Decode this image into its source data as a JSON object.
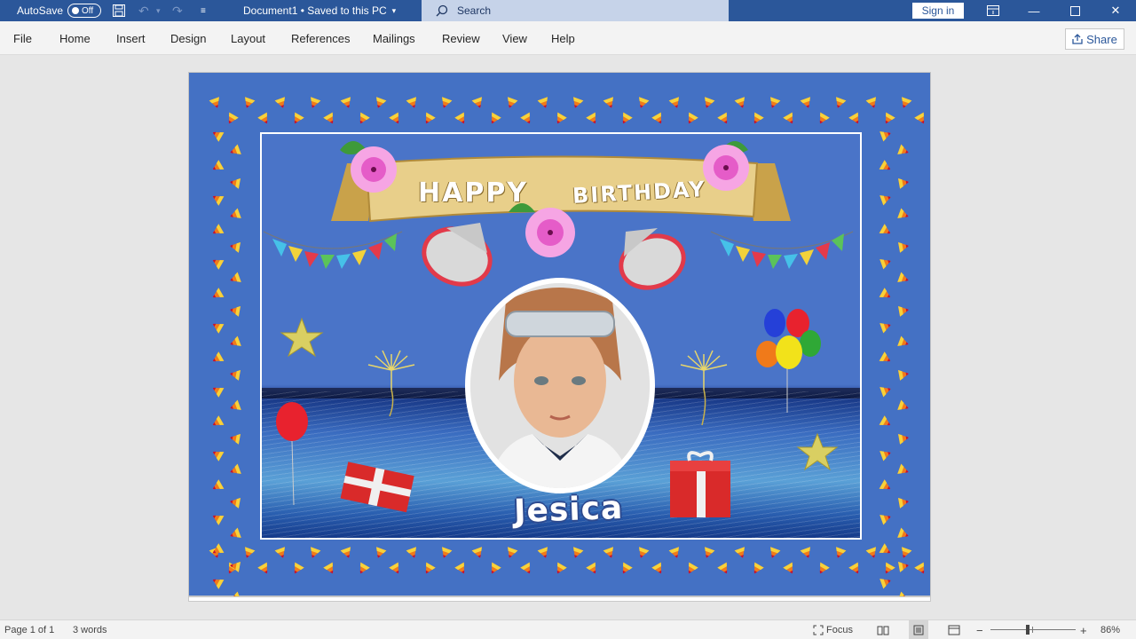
{
  "titlebar": {
    "autosave_label": "AutoSave",
    "autosave_state": "Off",
    "doc_title": "Document1 • Saved to this PC",
    "search_placeholder": "Search",
    "signin_label": "Sign in"
  },
  "ribbon": {
    "tabs": [
      "File",
      "Home",
      "Insert",
      "Design",
      "Layout",
      "References",
      "Mailings",
      "Review",
      "View",
      "Help"
    ],
    "share_label": "Share"
  },
  "document": {
    "banner_happy": "HAPPY",
    "banner_birthday": "BIRTHDAY",
    "name": "Jesica"
  },
  "statusbar": {
    "page_info": "Page 1 of 1",
    "word_count": "3 words",
    "focus_label": "Focus",
    "zoom_level": "86%"
  },
  "colors": {
    "title_bar": "#2b579a",
    "page_background": "#4471c4"
  }
}
